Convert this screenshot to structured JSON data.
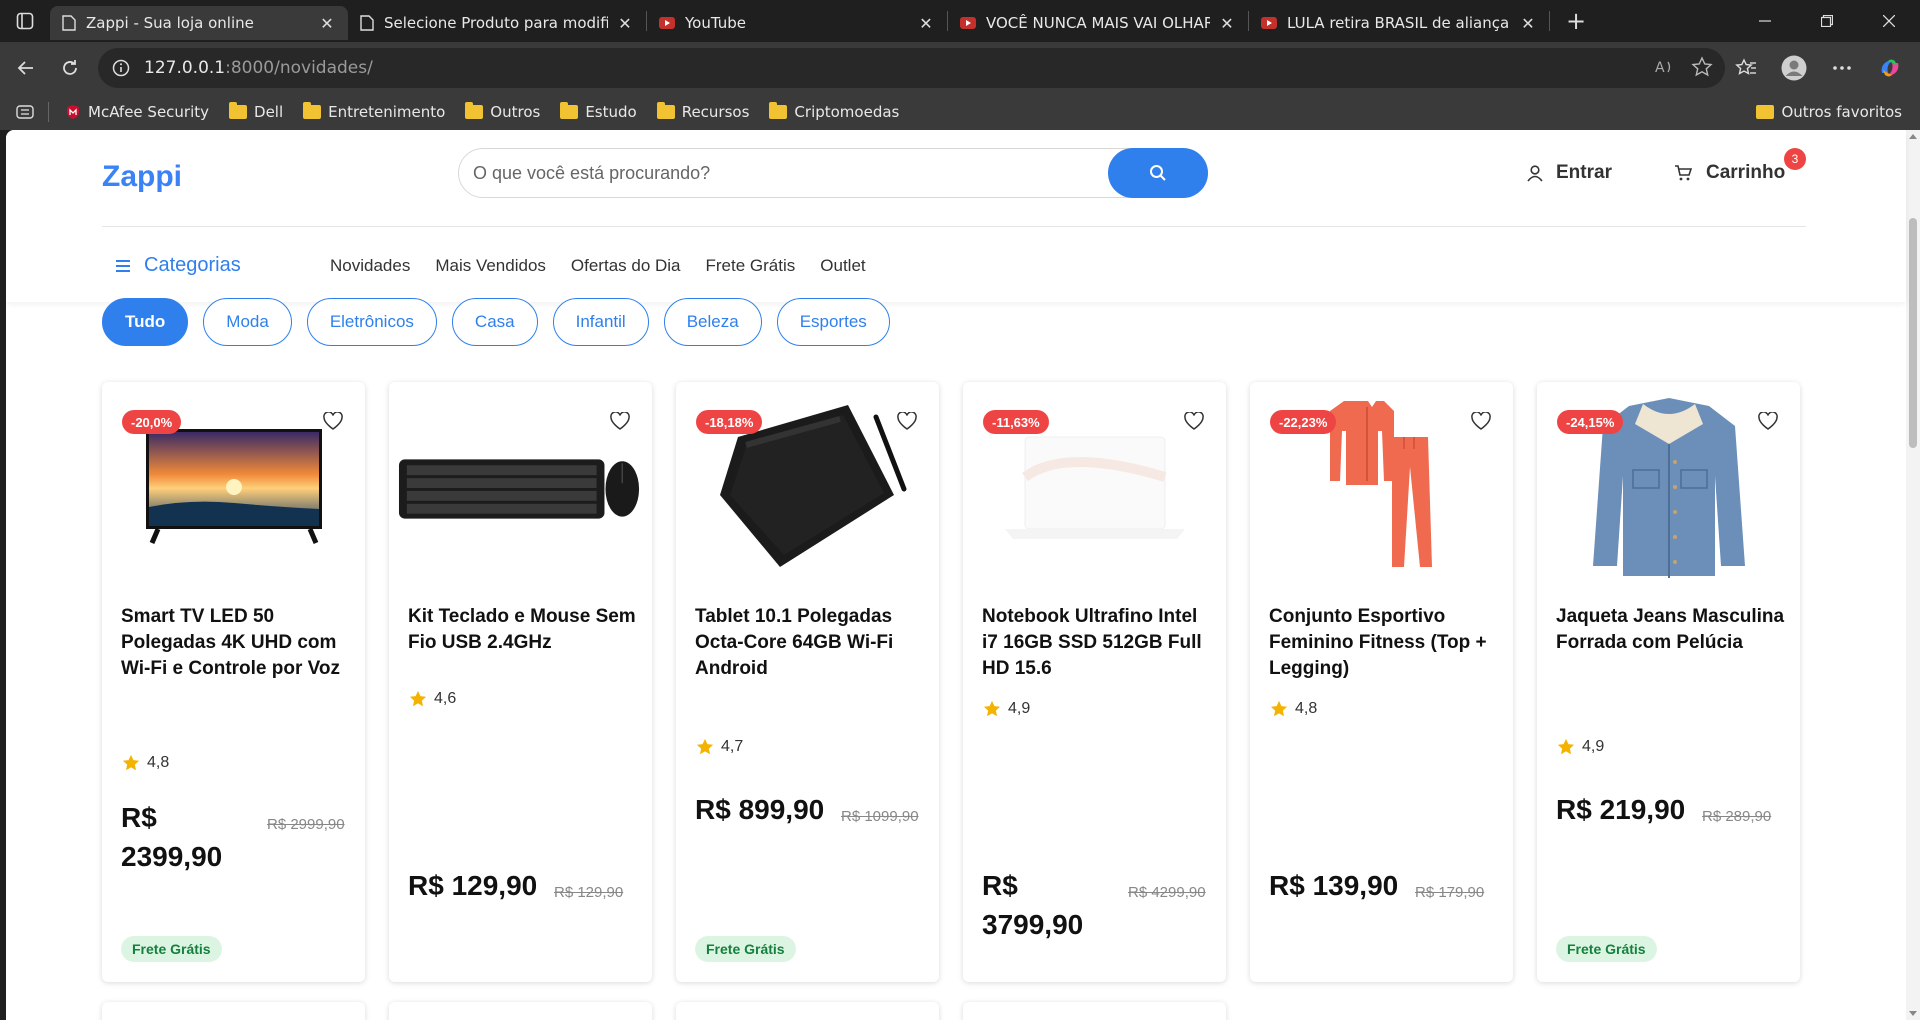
{
  "browser": {
    "tabs": [
      {
        "title": "Zappi - Sua loja online",
        "active": true,
        "icon": "page-icon"
      },
      {
        "title": "Selecione Produto para modificar",
        "active": false,
        "icon": "page-icon"
      },
      {
        "title": "YouTube",
        "active": false,
        "icon": "youtube-icon"
      },
      {
        "title": "VOCÊ NUNCA MAIS VAI OLHAR P",
        "active": false,
        "icon": "youtube-icon"
      },
      {
        "title": "LULA retira BRASIL de aliança em",
        "active": false,
        "icon": "youtube-icon"
      }
    ],
    "url_host": "127.0.0.1",
    "url_rest": ":8000/novidades/",
    "bookmarks": [
      "McAfee Security",
      "Dell",
      "Entretenimento",
      "Outros",
      "Estudo",
      "Recursos",
      "Criptomoedas"
    ],
    "bookmarks_right": "Outros favoritos"
  },
  "site": {
    "logo": "Zappi",
    "search_placeholder": "O que você está procurando?",
    "login_label": "Entrar",
    "cart_label": "Carrinho",
    "cart_count": "3",
    "categories_label": "Categorias",
    "nav": [
      "Novidades",
      "Mais Vendidos",
      "Ofertas do Dia",
      "Frete Grátis",
      "Outlet"
    ],
    "filters": [
      {
        "label": "Tudo",
        "active": true
      },
      {
        "label": "Moda",
        "active": false
      },
      {
        "label": "Eletrônicos",
        "active": false
      },
      {
        "label": "Casa",
        "active": false
      },
      {
        "label": "Infantil",
        "active": false
      },
      {
        "label": "Beleza",
        "active": false
      },
      {
        "label": "Esportes",
        "active": false
      }
    ]
  },
  "products": [
    {
      "discount": "-20,0%",
      "title": "Smart TV LED 50 Polegadas 4K UHD com Wi-Fi e Controle por Voz",
      "rating": "4,8",
      "price": "R$ 2399,90",
      "old_price": "R$ 2999,90",
      "frete": "Frete Grátis",
      "image": "tv-image"
    },
    {
      "discount": "",
      "title": "Kit Teclado e Mouse Sem Fio USB 2.4GHz",
      "rating": "4,6",
      "price": "R$ 129,90",
      "old_price": "R$ 129,90",
      "frete": "",
      "image": "keyboard-image"
    },
    {
      "discount": "-18,18%",
      "title": "Tablet 10.1 Polegadas Octa-Core 64GB Wi-Fi Android",
      "rating": "4,7",
      "price": "R$ 899,90",
      "old_price": "R$ 1099,90",
      "frete": "Frete Grátis",
      "image": "tablet-image"
    },
    {
      "discount": "-11,63%",
      "title": "Notebook Ultrafino Intel i7 16GB SSD 512GB Full HD 15.6",
      "rating": "4,9",
      "price": "R$ 3799,90",
      "old_price": "R$ 4299,90",
      "frete": "",
      "image": "notebook-image"
    },
    {
      "discount": "-22,23%",
      "title": "Conjunto Esportivo Feminino Fitness (Top + Legging)",
      "rating": "4,8",
      "price": "R$ 139,90",
      "old_price": "R$ 179,90",
      "frete": "",
      "image": "tracksuit-image"
    },
    {
      "discount": "-24,15%",
      "title": "Jaqueta Jeans Masculina Forrada com Pelúcia",
      "rating": "4,9",
      "price": "R$ 219,90",
      "old_price": "R$ 289,90",
      "frete": "Frete Grátis",
      "image": "jacket-image"
    }
  ],
  "colors": {
    "accent": "#2f80ed",
    "discount": "#ef4444",
    "frete_bg": "#dcf5e3",
    "frete_text": "#15803d",
    "star": "#f5b301"
  }
}
